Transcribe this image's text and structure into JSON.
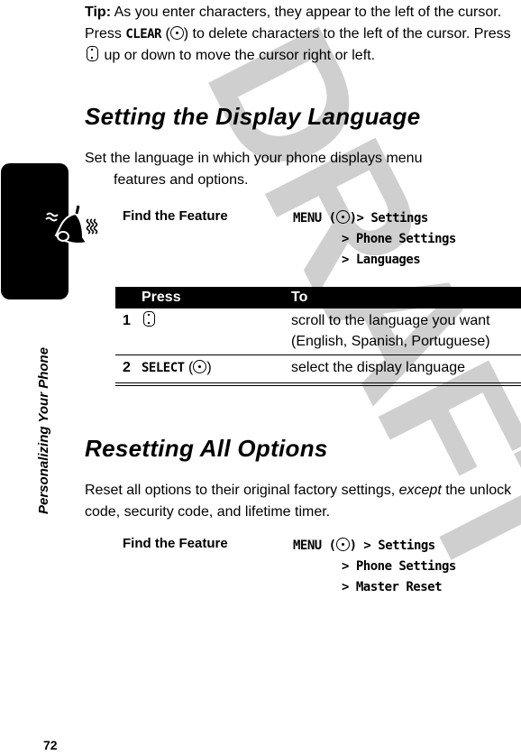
{
  "watermark": "DRAFT",
  "sidebar": {
    "section_title": "Personalizing Your Phone",
    "icon": "ringer-bell-icon"
  },
  "page_number": "72",
  "tip": {
    "label": "Tip:",
    "line1": " As you enter characters, they appear to the left of the cursor. Press ",
    "clear_key": "CLEAR",
    "line2": " to delete characters to the left of the cursor. Press ",
    "line3": " up or down to move the cursor right or left."
  },
  "section1": {
    "heading": "Setting the Display Language",
    "intro_line1": "Set the language in which your phone displays menu",
    "intro_line2": "features and options.",
    "find_feature": {
      "label": "Find the Feature",
      "menu_key": "MENU",
      "path": [
        "Settings",
        "Phone Settings",
        "Languages"
      ]
    },
    "table": {
      "headers": [
        "",
        "Press",
        "To"
      ],
      "rows": [
        {
          "num": "1",
          "press_icon": "nav-key-icon",
          "press": "",
          "to": "scroll to the language you want (English, Spanish, Portuguese)"
        },
        {
          "num": "2",
          "press": "SELECT",
          "press_icon": "center-key-icon",
          "to": "select the display language"
        }
      ]
    }
  },
  "section2": {
    "heading": "Resetting All Options",
    "body_before": "Reset all options to their original factory settings, ",
    "body_emphasis": "except",
    "body_after": " the unlock code, security code, and lifetime timer.",
    "find_feature": {
      "label": "Find the Feature",
      "menu_key": "MENU",
      "path": [
        "Settings",
        "Phone Settings",
        "Master Reset"
      ]
    }
  }
}
